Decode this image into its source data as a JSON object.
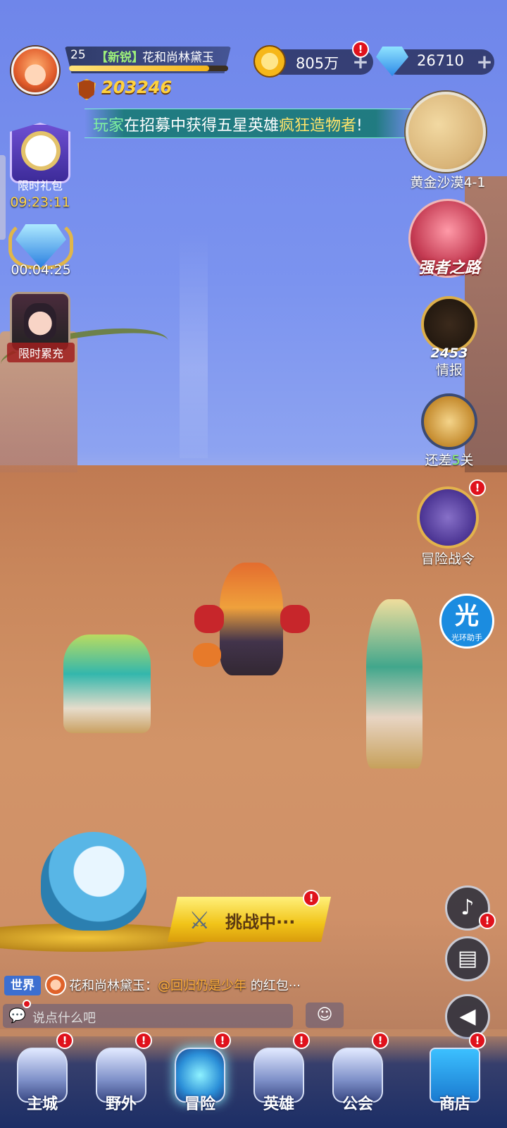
{
  "player": {
    "level": "25",
    "tag": "【新锐】",
    "name": "花和尚林黛玉",
    "power": "203246",
    "exp_progress": 0.88
  },
  "resources": {
    "gold": "805万",
    "gems": "26710",
    "plus": "+",
    "alert": "!"
  },
  "announcement": {
    "prefix": "玩家",
    "text": "在招募中获得五星英雄",
    "highlight": "疯狂造物者",
    "suffix": "!"
  },
  "map": {
    "label": "黄金沙漠4-1"
  },
  "left_icons": {
    "gift_label": "限时礼包",
    "gift_timer": "09:23:11",
    "diamond_timer": "00:04:25",
    "charge_label": "限时累充"
  },
  "right_icons": {
    "strong_label": "强者之路",
    "intel_count": "2453",
    "intel_label": "情报",
    "stage_prefix": "还差",
    "stage_count": "5",
    "stage_suffix": "关",
    "pass_label": "冒险战令",
    "halo_big": "光",
    "halo_small": "光环助手"
  },
  "challenge": {
    "label": "挑战中···"
  },
  "chat": {
    "channel": "世界",
    "sender": "花和尚林黛玉：",
    "mention": "@回归仍是少年",
    "tail": " 的红包···",
    "placeholder": "说点什么吧"
  },
  "nav": {
    "items": [
      {
        "label": "主城"
      },
      {
        "label": "野外"
      },
      {
        "label": "冒险"
      },
      {
        "label": "英雄"
      },
      {
        "label": "公会"
      },
      {
        "label": "商店"
      }
    ]
  },
  "colors": {
    "accent_gold": "#ffd23d",
    "alert_red": "#e0121c",
    "tag_green": "#9df07a",
    "highlight_yellow": "#ffe46a"
  },
  "icons": [
    "avatar",
    "power-shield-icon",
    "coin-icon",
    "gem-icon",
    "clock-icon",
    "diamond-icon",
    "intel-magnifier-icon",
    "scroll-icon",
    "pass-icon",
    "halo-icon",
    "swords-icon",
    "horn-icon",
    "book-icon",
    "megaphone-icon",
    "chat-icon",
    "emoji-icon"
  ]
}
